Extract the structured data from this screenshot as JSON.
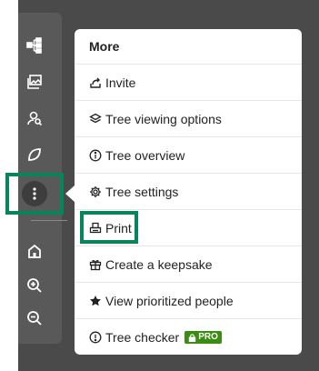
{
  "toolbar": {
    "buttons": [
      {
        "name": "tree-structure-icon"
      },
      {
        "name": "photos-icon"
      },
      {
        "name": "search-person-icon"
      },
      {
        "name": "hints-leaf-icon"
      },
      {
        "name": "more-icon"
      },
      {
        "name": "home-icon"
      },
      {
        "name": "zoom-in-icon"
      },
      {
        "name": "zoom-out-icon"
      }
    ]
  },
  "menu": {
    "header": "More",
    "items": [
      {
        "label": "Invite",
        "icon": "share-icon"
      },
      {
        "label": "Tree viewing options",
        "icon": "layers-icon"
      },
      {
        "label": "Tree overview",
        "icon": "info-icon"
      },
      {
        "label": "Tree settings",
        "icon": "gear-icon"
      },
      {
        "label": "Print",
        "icon": "printer-icon"
      },
      {
        "label": "Create a keepsake",
        "icon": "gift-icon"
      },
      {
        "label": "View prioritized people",
        "icon": "star-icon"
      },
      {
        "label": "Tree checker",
        "icon": "alert-icon",
        "badge": "PRO"
      }
    ]
  },
  "colors": {
    "highlight": "#07855a",
    "pro_badge": "#3a8c12",
    "toolbar_bg": "#595959",
    "page_bg": "#4a4a4a"
  }
}
